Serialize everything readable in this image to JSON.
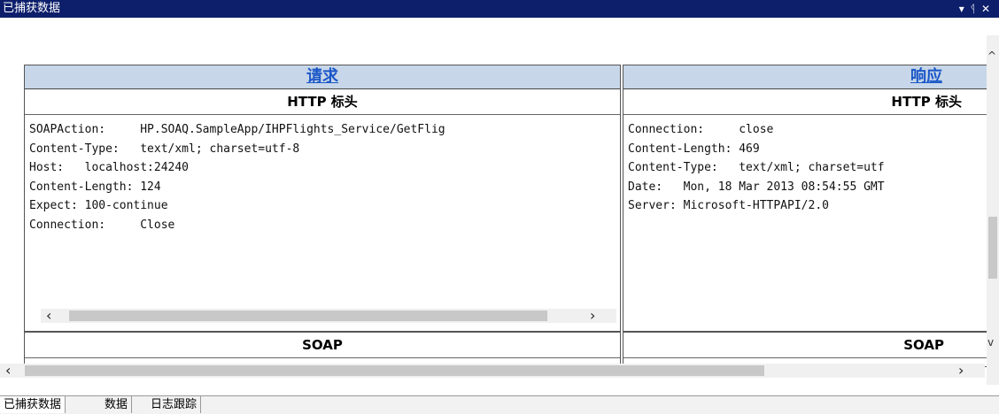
{
  "window": {
    "title": "已捕获数据",
    "controls": [
      "▾",
      "ᛩ",
      "✕"
    ]
  },
  "request_panel": {
    "header_link": "请求",
    "http_section": "HTTP 标头",
    "headers_text": "SOAPAction:     HP.SOAQ.SampleApp/IHPFlights_Service/GetFlig\nContent-Type:   text/xml; charset=utf-8\nHost:   localhost:24240\nContent-Length: 124\nExpect: 100-continue\nConnection:     Close",
    "soap_section": "SOAP"
  },
  "response_panel": {
    "header_link": "响应",
    "http_section": "HTTP 标头",
    "headers_text": "Connection:     close\nContent-Length: 469\nContent-Type:   text/xml; charset=utf\nDate:   Mon, 18 Mar 2013 08:54:55 GMT\nServer: Microsoft-HTTPAPI/2.0",
    "soap_section": "SOAP"
  },
  "tabs": [
    {
      "label": "已捕获数据",
      "active": true
    },
    {
      "label": "数据",
      "active": false
    },
    {
      "label": "日志跟踪",
      "active": false
    }
  ],
  "colors": {
    "titlebar": "#0d1f6b",
    "panel_header": "#c7d6e8",
    "link": "#1a57c8"
  },
  "icons": {
    "scroll_left": "‹",
    "scroll_right": "›",
    "scroll_up": "^",
    "scroll_down": "v"
  }
}
